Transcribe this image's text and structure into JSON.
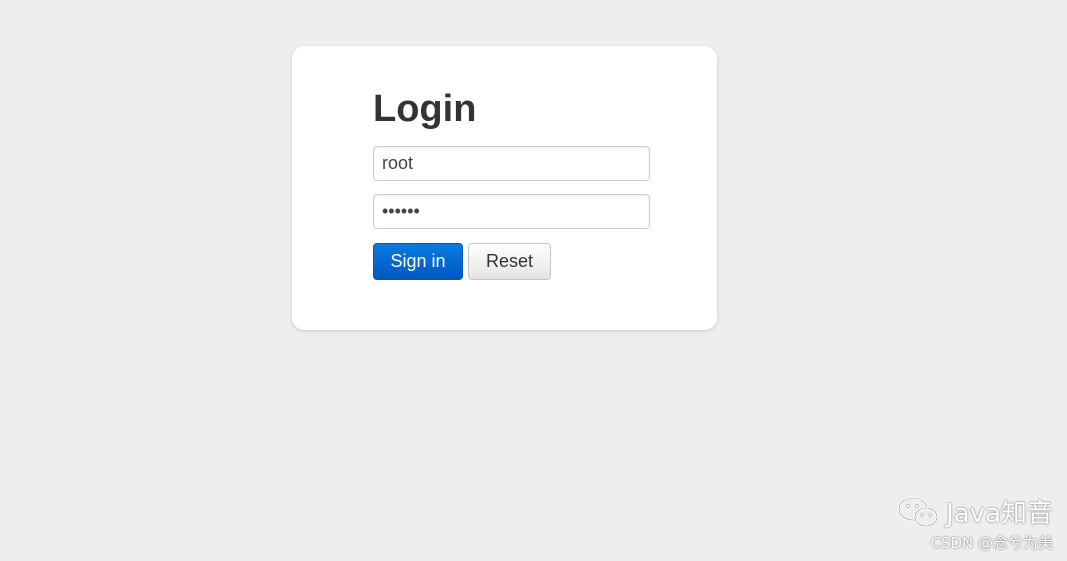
{
  "login": {
    "title": "Login",
    "username_value": "root",
    "password_value": "••••••",
    "signin_label": "Sign in",
    "reset_label": "Reset"
  },
  "watermark": {
    "icon": "wechat-icon",
    "brand": "Java知音",
    "credit": "CSDN @念兮为美"
  },
  "colors": {
    "background": "#eeeeee",
    "card": "#ffffff",
    "primary_button": "#0066cc"
  }
}
